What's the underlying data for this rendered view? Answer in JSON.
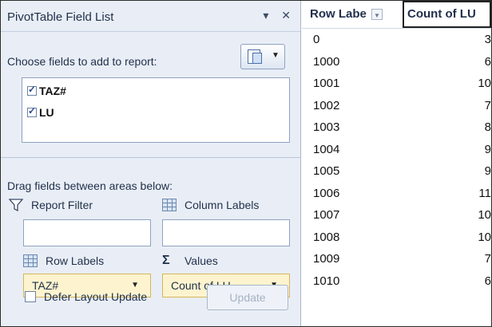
{
  "pane": {
    "title": "PivotTable Field List",
    "choose_text": "Choose fields to add to report:",
    "fields": [
      {
        "label": "TAZ#",
        "checked": true
      },
      {
        "label": "LU",
        "checked": true
      }
    ],
    "drag_text": "Drag fields between areas below:",
    "areas": {
      "report_filter": "Report Filter",
      "column_labels": "Column Labels",
      "row_labels": "Row Labels",
      "values": "Values"
    },
    "row_field": "TAZ#",
    "value_field": "Count of LU",
    "defer_label": "Defer Layout Update",
    "update_label": "Update"
  },
  "sheet": {
    "row_header": "Row Labe",
    "count_header": "Count of LU",
    "rows": [
      {
        "key": "0",
        "value": "3"
      },
      {
        "key": "1000",
        "value": "6"
      },
      {
        "key": "1001",
        "value": "10"
      },
      {
        "key": "1002",
        "value": "7"
      },
      {
        "key": "1003",
        "value": "8"
      },
      {
        "key": "1004",
        "value": "9"
      },
      {
        "key": "1005",
        "value": "9"
      },
      {
        "key": "1006",
        "value": "11"
      },
      {
        "key": "1007",
        "value": "10"
      },
      {
        "key": "1008",
        "value": "10"
      },
      {
        "key": "1009",
        "value": "7"
      },
      {
        "key": "1010",
        "value": "6"
      }
    ]
  }
}
